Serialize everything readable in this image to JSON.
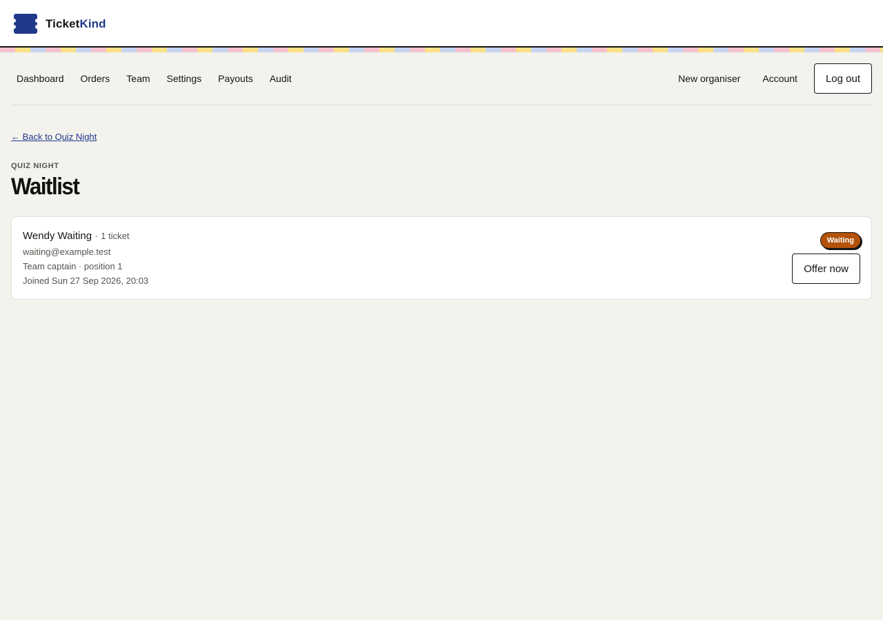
{
  "brand": {
    "name_part1": "Ticket",
    "name_part2": "Kind",
    "logo_icon": "ticket-icon"
  },
  "nav": {
    "left": [
      "Dashboard",
      "Orders",
      "Team",
      "Settings",
      "Payouts",
      "Audit"
    ],
    "right": [
      "New organiser",
      "Account"
    ],
    "logout_label": "Log out"
  },
  "back_link": "← Back to Quiz Night",
  "eyebrow": "QUIZ NIGHT",
  "page_title": "Waitlist",
  "entries": [
    {
      "name": "Wendy Waiting",
      "separator": "·",
      "tickets": "1 ticket",
      "email": "waiting@example.test",
      "role_position": "Team captain · position 1",
      "joined": "Joined Sun 27 Sep 2026, 20:03",
      "status": "Waiting",
      "action_label": "Offer now"
    }
  ],
  "colors": {
    "accent": "#20398a",
    "background": "#f3f2ed",
    "status_waiting": "#b4520a",
    "stripe": [
      "#f4c1cf",
      "#fbe187",
      "#c6d5f1"
    ]
  }
}
